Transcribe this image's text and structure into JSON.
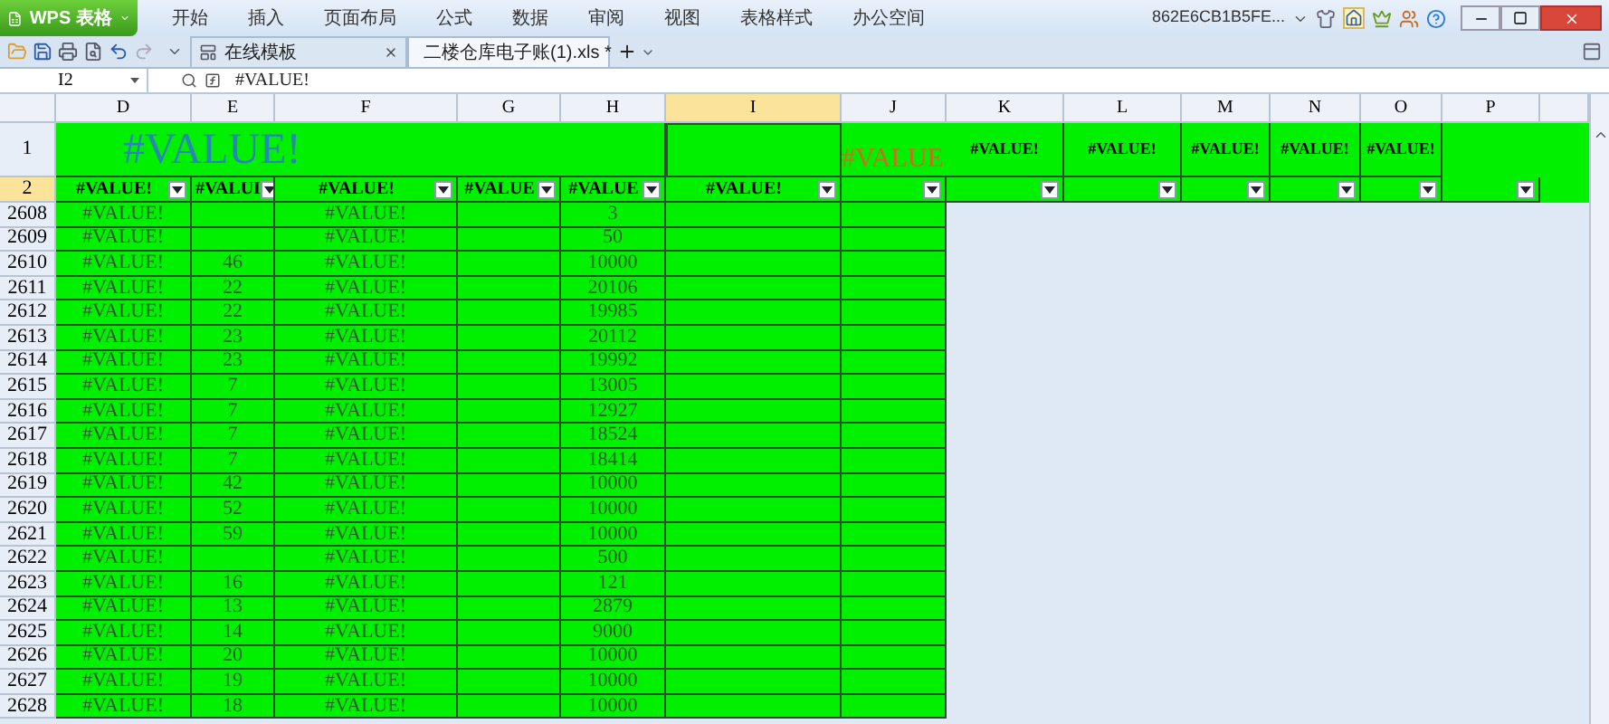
{
  "app_button": {
    "label": "WPS 表格"
  },
  "menu": [
    {
      "label": "开始"
    },
    {
      "label": "插入"
    },
    {
      "label": "页面布局"
    },
    {
      "label": "公式"
    },
    {
      "label": "数据"
    },
    {
      "label": "审阅"
    },
    {
      "label": "视图"
    },
    {
      "label": "表格样式"
    },
    {
      "label": "办公空间"
    }
  ],
  "account": "862E6CB1B5FE...",
  "doc_tabs": [
    {
      "label": "在线模板",
      "selected": false
    },
    {
      "label": "二楼仓库电子账(1).xls *",
      "selected": true
    }
  ],
  "name_box": "I2",
  "formula": "#VALUE!",
  "columns": [
    {
      "label": "D",
      "selected": false
    },
    {
      "label": "E",
      "selected": false
    },
    {
      "label": "F",
      "selected": false
    },
    {
      "label": "G",
      "selected": false
    },
    {
      "label": "H",
      "selected": false
    },
    {
      "label": "I",
      "selected": true
    },
    {
      "label": "J",
      "selected": false
    },
    {
      "label": "K",
      "selected": false
    },
    {
      "label": "L",
      "selected": false
    },
    {
      "label": "M",
      "selected": false
    },
    {
      "label": "N",
      "selected": false
    },
    {
      "label": "O",
      "selected": false
    },
    {
      "label": "P",
      "selected": false
    }
  ],
  "row1": {
    "number": "1",
    "title": "#VALUE!",
    "j_text": "#VALUE",
    "headers": [
      "#VALUE!",
      "#VALUE!",
      "#VALUE!",
      "#VALUE!",
      "#VALUE!"
    ]
  },
  "row2": {
    "number": "2",
    "selected": true,
    "filters": [
      {
        "kind": "labeled",
        "text": "#VALUE!"
      },
      {
        "kind": "labeled",
        "text": "#VALUI"
      },
      {
        "kind": "labeled",
        "text": "#VALUE!"
      },
      {
        "kind": "labeled",
        "text": "#VALUE"
      },
      {
        "kind": "labeled",
        "text": "#VALUE"
      },
      {
        "kind": "labeled",
        "text": "#VALUE!"
      },
      {
        "kind": "blank"
      },
      {
        "kind": "blank"
      },
      {
        "kind": "blank"
      },
      {
        "kind": "blank"
      },
      {
        "kind": "blank"
      },
      {
        "kind": "blank"
      },
      {
        "kind": "blank"
      }
    ]
  },
  "rows": [
    {
      "number": "2608",
      "d": "#VALUE!",
      "f": "#VALUE!",
      "h": "3"
    },
    {
      "number": "2609",
      "d": "#VALUE!",
      "f": "#VALUE!",
      "h": "50"
    },
    {
      "number": "2610",
      "d": "#VALUE!",
      "e": "46",
      "f": "#VALUE!",
      "h": "10000"
    },
    {
      "number": "2611",
      "d": "#VALUE!",
      "e": "22",
      "f": "#VALUE!",
      "h": "20106"
    },
    {
      "number": "2612",
      "d": "#VALUE!",
      "e": "22",
      "f": "#VALUE!",
      "h": "19985"
    },
    {
      "number": "2613",
      "d": "#VALUE!",
      "e": "23",
      "f": "#VALUE!",
      "h": "20112"
    },
    {
      "number": "2614",
      "d": "#VALUE!",
      "e": "23",
      "f": "#VALUE!",
      "h": "19992"
    },
    {
      "number": "2615",
      "d": "#VALUE!",
      "e": "7",
      "f": "#VALUE!",
      "h": "13005"
    },
    {
      "number": "2616",
      "d": "#VALUE!",
      "e": "7",
      "f": "#VALUE!",
      "h": "12927"
    },
    {
      "number": "2617",
      "d": "#VALUE!",
      "e": "7",
      "f": "#VALUE!",
      "h": "18524"
    },
    {
      "number": "2618",
      "d": "#VALUE!",
      "e": "7",
      "f": "#VALUE!",
      "h": "18414"
    },
    {
      "number": "2619",
      "d": "#VALUE!",
      "e": "42",
      "f": "#VALUE!",
      "h": "10000"
    },
    {
      "number": "2620",
      "d": "#VALUE!",
      "e": "52",
      "f": "#VALUE!",
      "h": "10000"
    },
    {
      "number": "2621",
      "d": "#VALUE!",
      "e": "59",
      "f": "#VALUE!",
      "h": "10000"
    },
    {
      "number": "2622",
      "d": "#VALUE!",
      "f": "#VALUE!",
      "h": "500"
    },
    {
      "number": "2623",
      "d": "#VALUE!",
      "e": "16",
      "f": "#VALUE!",
      "h": "121"
    },
    {
      "number": "2624",
      "d": "#VALUE!",
      "e": "13",
      "f": "#VALUE!",
      "h": "2879"
    },
    {
      "number": "2625",
      "d": "#VALUE!",
      "e": "14",
      "f": "#VALUE!",
      "h": "9000"
    },
    {
      "number": "2626",
      "d": "#VALUE!",
      "e": "20",
      "f": "#VALUE!",
      "h": "10000"
    },
    {
      "number": "2627",
      "d": "#VALUE!",
      "e": "19",
      "f": "#VALUE!",
      "h": "10000"
    },
    {
      "number": "2628",
      "d": "#VALUE!",
      "e": "18",
      "f": "#VALUE!",
      "h": "10000"
    }
  ]
}
